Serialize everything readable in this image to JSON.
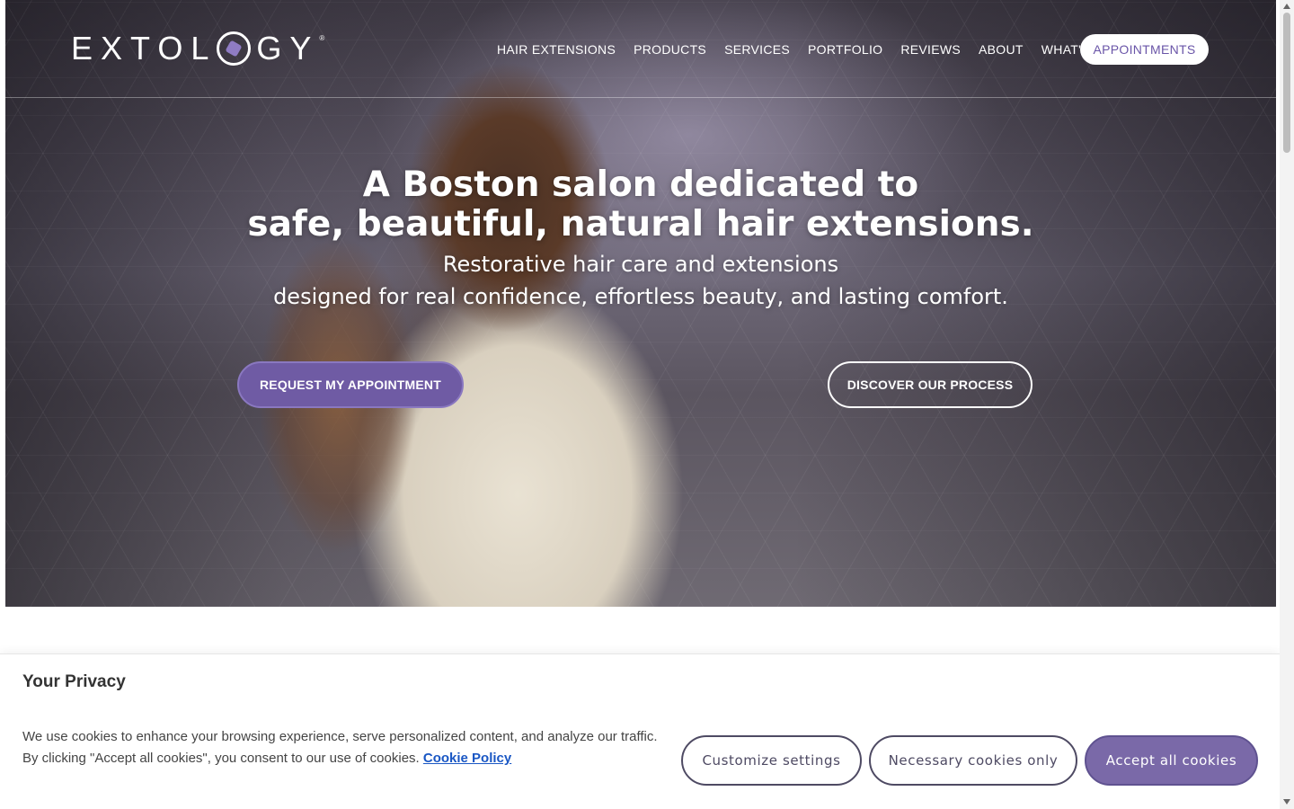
{
  "brand": {
    "logo_text_left": "EXTOL",
    "logo_text_right": "GY",
    "accent": "#6f5ba4"
  },
  "nav": {
    "items": [
      {
        "label": "HAIR EXTENSIONS"
      },
      {
        "label": "PRODUCTS"
      },
      {
        "label": "SERVICES"
      },
      {
        "label": "PORTFOLIO"
      },
      {
        "label": "REVIEWS"
      },
      {
        "label": "ABOUT"
      },
      {
        "label": "WHAT'S NEW?"
      }
    ],
    "appointments_label": "APPOINTMENTS"
  },
  "hero": {
    "title_line1": "A Boston salon dedicated to",
    "title_line2": "safe, beautiful, natural hair extensions.",
    "sub_line1": "Restorative hair care and extensions",
    "sub_line2": "designed for real confidence, effortless beauty, and lasting comfort.",
    "cta_primary": "REQUEST MY APPOINTMENT",
    "cta_secondary": "DISCOVER OUR PROCESS"
  },
  "cookie": {
    "title": "Your Privacy",
    "text_line1": "We use cookies to enhance your browsing experience, serve personalized content, and analyze our traffic.",
    "text_line2": "By clicking \"Accept all cookies\", you consent to our use of cookies.",
    "policy_link": "Cookie Policy",
    "customize": "Customize settings",
    "necessary": "Necessary cookies only",
    "accept": "Accept all cookies"
  }
}
